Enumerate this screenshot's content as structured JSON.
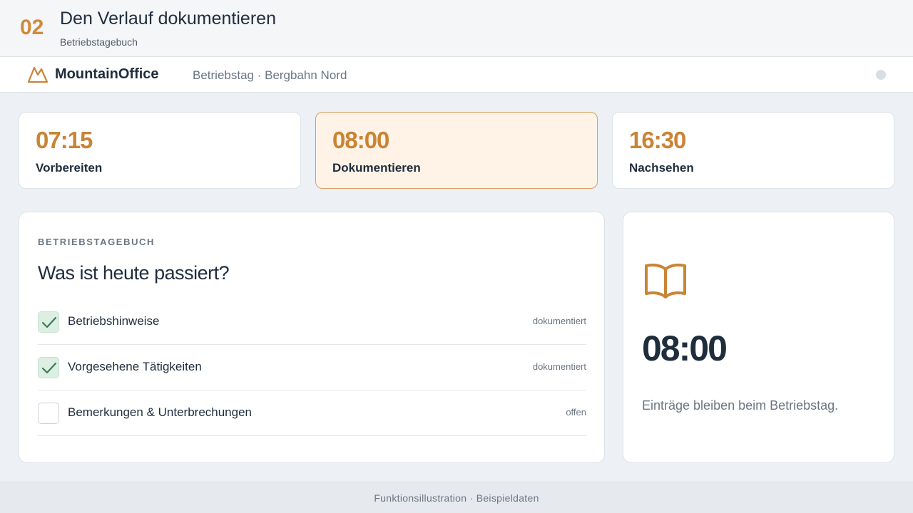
{
  "header": {
    "step_number": "02",
    "title": "Den Verlauf dokumentieren",
    "subtitle": "Betriebstagebuch"
  },
  "appbar": {
    "brand": "MountainOffice",
    "logo_icon": "mountain-icon",
    "context": "Betriebstag · Bergbahn Nord"
  },
  "timeline": [
    {
      "time": "07:15",
      "label": "Vorbereiten",
      "active": false
    },
    {
      "time": "08:00",
      "label": "Dokumentieren",
      "active": true
    },
    {
      "time": "16:30",
      "label": "Nachsehen",
      "active": false
    }
  ],
  "journal": {
    "eyebrow": "BETRIEBSTAGEBUCH",
    "question": "Was ist heute passiert?",
    "items": [
      {
        "label": "Betriebshinweise",
        "checked": true,
        "state": "dokumentiert"
      },
      {
        "label": "Vorgesehene Tätigkeiten",
        "checked": true,
        "state": "dokumentiert"
      },
      {
        "label": "Bemerkungen & Unterbrechungen",
        "checked": false,
        "state": "offen"
      }
    ]
  },
  "side": {
    "icon": "book-icon",
    "time": "08:00",
    "note": "Einträge bleiben beim Betriebstag."
  },
  "footer": {
    "text": "Funktionsillustration · Beispieldaten"
  },
  "colors": {
    "accent": "#c98436",
    "active_bg": "#fef3e6",
    "check_bg": "#dcefe2",
    "check_mark": "#3f7a56"
  }
}
